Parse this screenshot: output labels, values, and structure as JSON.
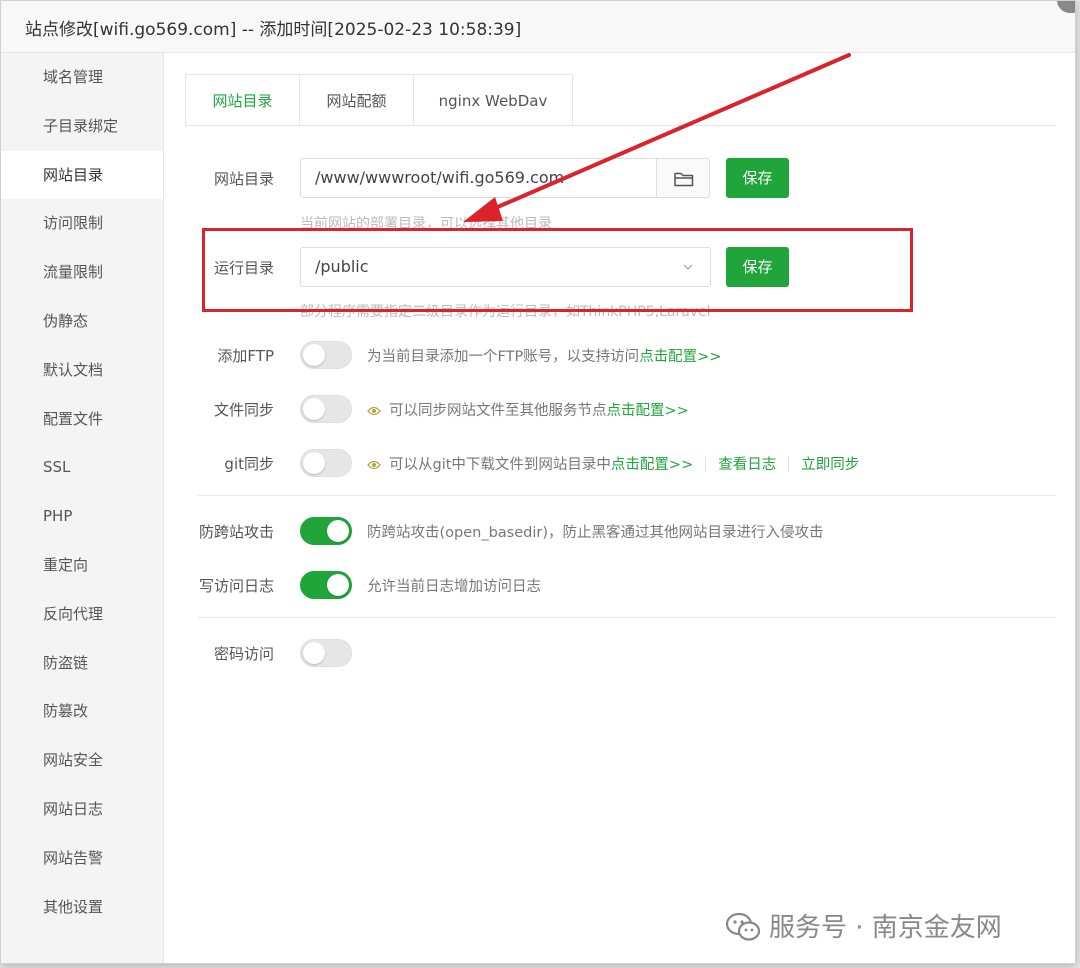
{
  "title": "站点修改[wifi.go569.com] -- 添加时间[2025-02-23 10:58:39]",
  "sidebar": {
    "items": [
      {
        "label": "域名管理"
      },
      {
        "label": "子目录绑定"
      },
      {
        "label": "网站目录"
      },
      {
        "label": "访问限制"
      },
      {
        "label": "流量限制"
      },
      {
        "label": "伪静态"
      },
      {
        "label": "默认文档"
      },
      {
        "label": "配置文件"
      },
      {
        "label": "SSL"
      },
      {
        "label": "PHP"
      },
      {
        "label": "重定向"
      },
      {
        "label": "反向代理"
      },
      {
        "label": "防盗链"
      },
      {
        "label": "防篡改"
      },
      {
        "label": "网站安全"
      },
      {
        "label": "网站日志"
      },
      {
        "label": "网站告警"
      },
      {
        "label": "其他设置"
      }
    ],
    "active_index": 2
  },
  "tabs": [
    {
      "label": "网站目录"
    },
    {
      "label": "网站配额"
    },
    {
      "label": "nginx WebDav"
    }
  ],
  "form": {
    "site_dir": {
      "label": "网站目录",
      "value": "/www/wwwroot/wifi.go569.com",
      "save_label": "保存",
      "hint": "当前网站的部署目录，可以选择其他目录"
    },
    "run_dir": {
      "label": "运行目录",
      "value": "/public",
      "save_label": "保存",
      "hint": "部分程序需要指定二级目录作为运行目录，如ThinkPHP5,Laravel"
    },
    "ftp": {
      "label": "添加FTP",
      "enabled": false,
      "desc": "为当前目录添加一个FTP账号，以支持访问",
      "link": "点击配置>>"
    },
    "file_sync": {
      "label": "文件同步",
      "enabled": false,
      "desc": "可以同步网站文件至其他服务节点",
      "link": "点击配置>>"
    },
    "git_sync": {
      "label": "git同步",
      "enabled": false,
      "desc": "可以从git中下载文件到网站目录中",
      "link": "点击配置>>",
      "view_log": "查看日志",
      "sync_now": "立即同步"
    },
    "anti_xss": {
      "label": "防跨站攻击",
      "enabled": true,
      "desc": "防跨站攻击(open_basedir)，防止黑客通过其他网站目录进行入侵攻击"
    },
    "access_log": {
      "label": "写访问日志",
      "enabled": true,
      "desc": "允许当前日志增加访问日志"
    },
    "password_access": {
      "label": "密码访问",
      "enabled": false
    }
  },
  "watermark": "服务号 · 南京金友网",
  "colors": {
    "accent": "#20a53a",
    "annotation": "#d9232d"
  }
}
